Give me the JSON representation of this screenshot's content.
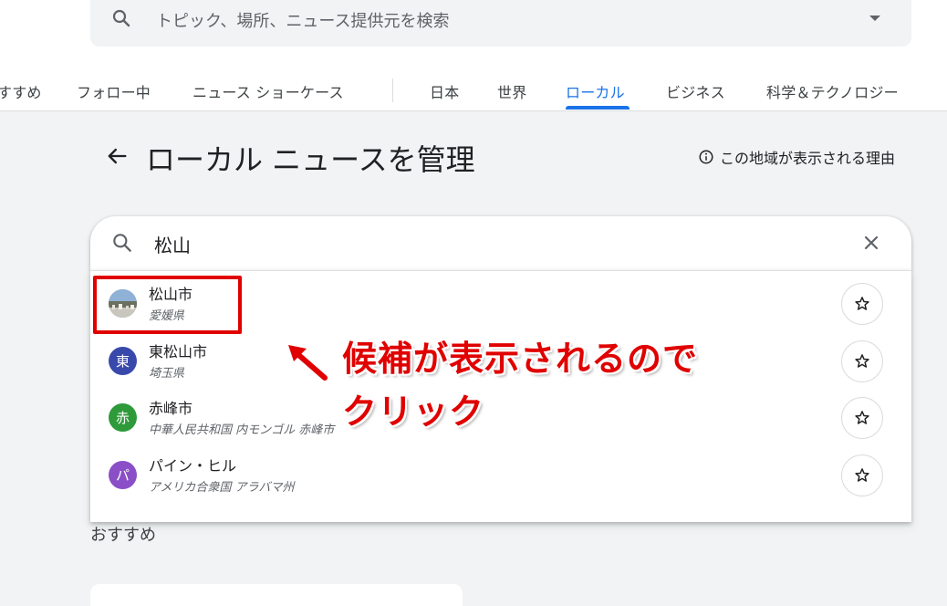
{
  "header": {
    "search_placeholder": "トピック、場所、ニュース提供元を検索",
    "tabs": [
      {
        "label": "すすめ"
      },
      {
        "label": "フォロー中"
      },
      {
        "label": "ニュース ショーケース"
      },
      {
        "label": "日本"
      },
      {
        "label": "世界"
      },
      {
        "label": "ローカル"
      },
      {
        "label": "ビジネス"
      },
      {
        "label": "科学＆テクノロジー"
      }
    ],
    "active_tab": "ローカル"
  },
  "page": {
    "title": "ローカル ニュースを管理",
    "why_link": "この地域が表示される理由"
  },
  "local_search": {
    "query": "松山",
    "results": [
      {
        "name": "松山市",
        "sub": "愛媛県",
        "avatar": "",
        "avatar_color": "#6b7b8c"
      },
      {
        "name": "東松山市",
        "sub": "埼玉県",
        "avatar": "東",
        "avatar_color": "#3949ab"
      },
      {
        "name": "赤峰市",
        "sub": "中華人民共和国 内モンゴル 赤峰市",
        "avatar": "赤",
        "avatar_color": "#2e9a3a"
      },
      {
        "name": "パイン・ヒル",
        "sub": "アメリカ合衆国 アラバマ州",
        "avatar": "パ",
        "avatar_color": "#8a4fc7"
      }
    ]
  },
  "section": {
    "recommend": "おすすめ"
  },
  "annotation": {
    "line1": "候補が表示されるので",
    "line2": "クリック",
    "color": "#e00000"
  },
  "colors": {
    "accent": "#1a73e8",
    "background": "#f1f3f4"
  }
}
